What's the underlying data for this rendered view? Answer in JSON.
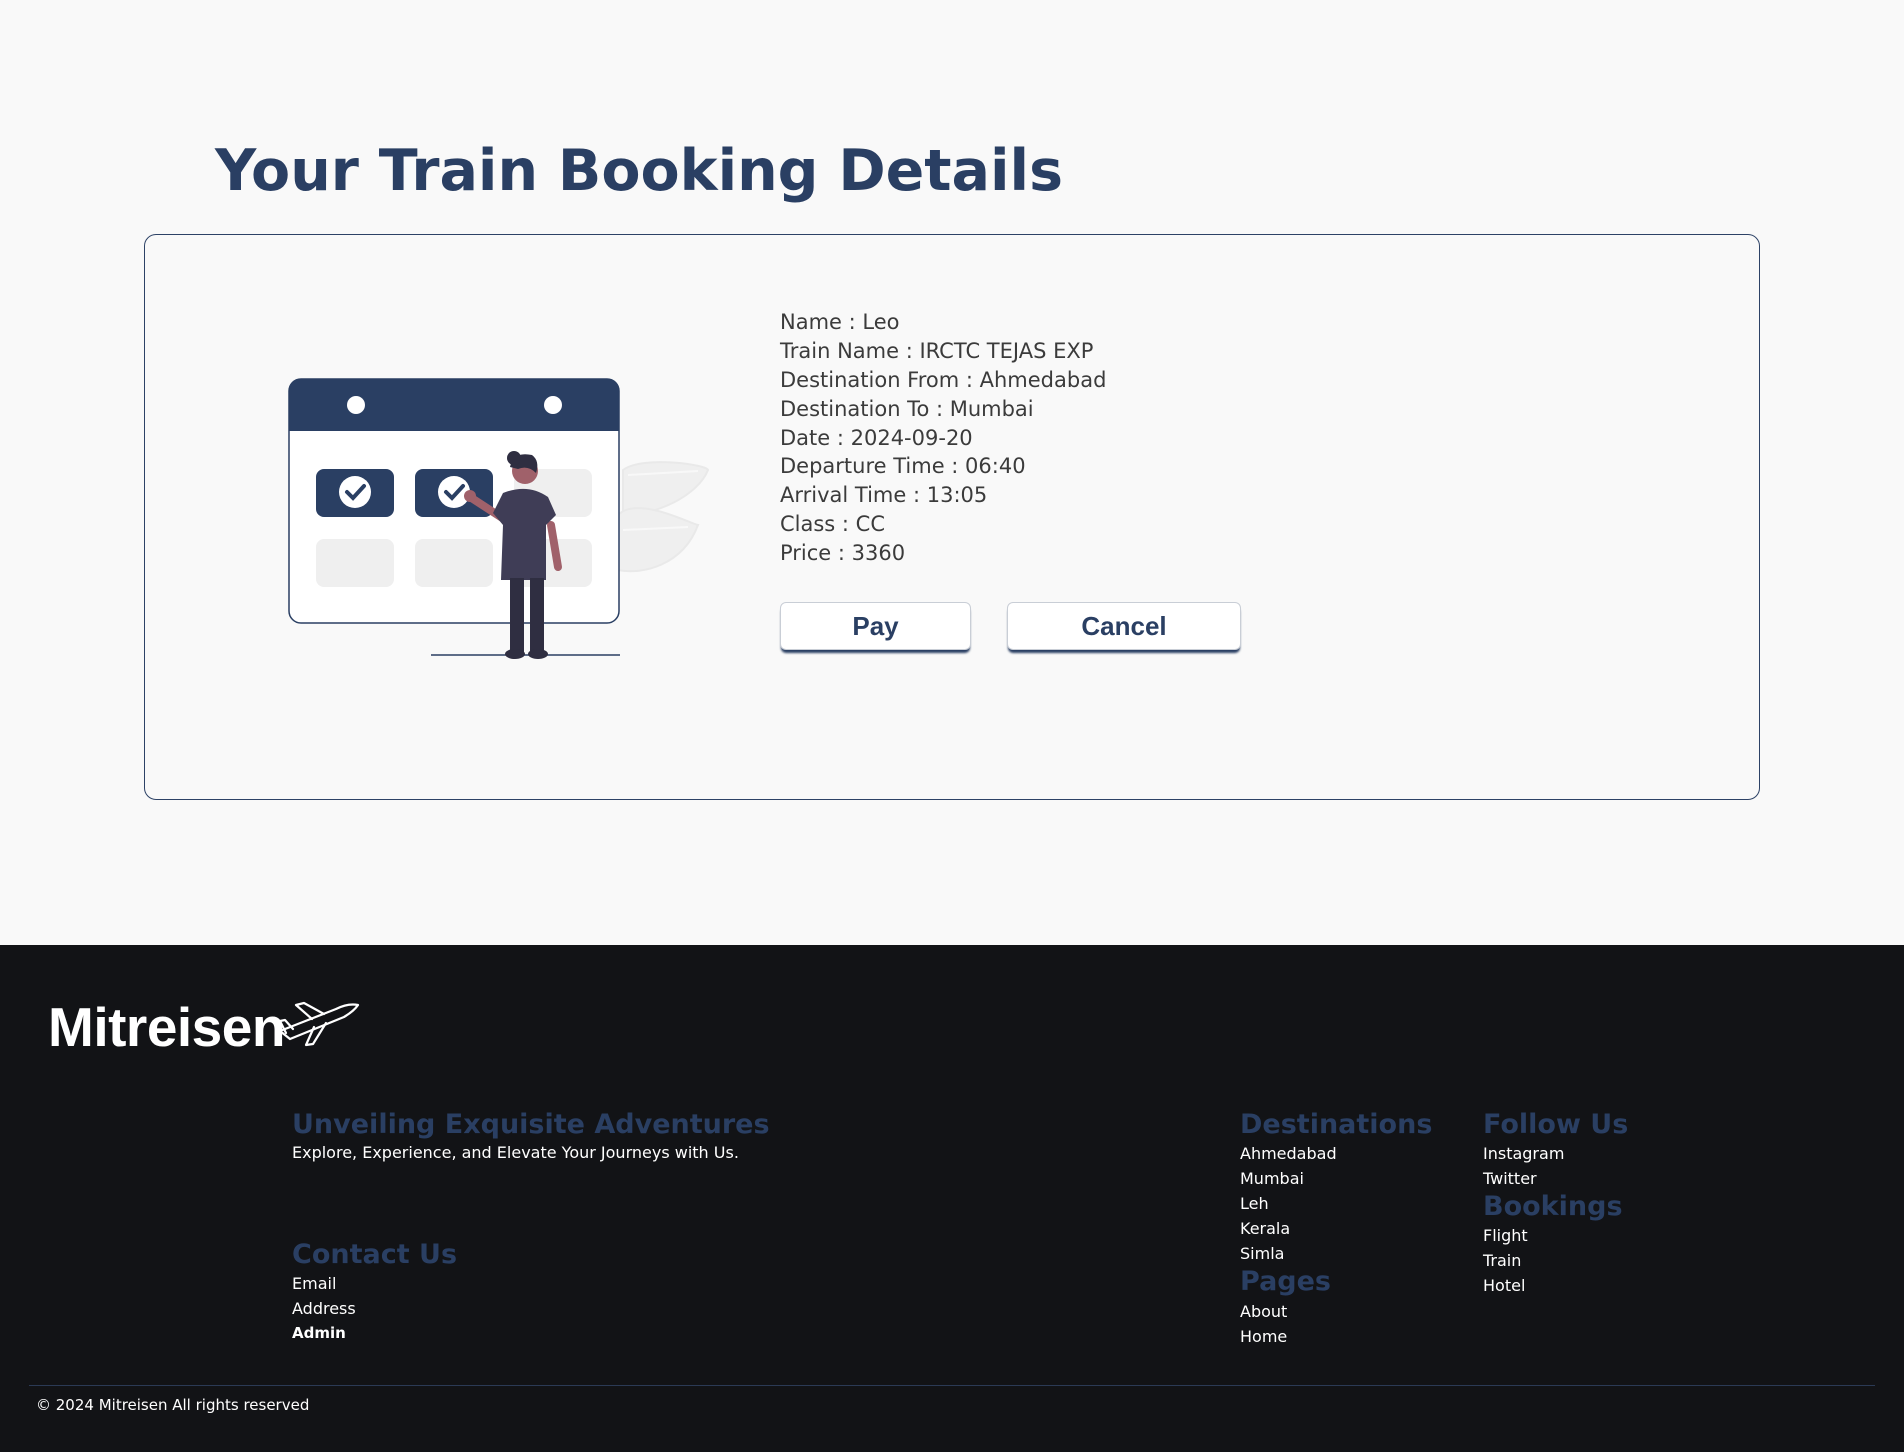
{
  "page": {
    "title": "Your Train Booking Details"
  },
  "booking": {
    "lines": [
      "Name : Leo",
      "Train Name : IRCTC TEJAS EXP",
      "Destination From : Ahmedabad",
      "Destination To : Mumbai",
      "Date : 2024-09-20",
      "Departure Time : 06:40",
      "Arrival Time : 13:05",
      "Class : CC",
      "Price : 3360"
    ],
    "pay_label": "Pay",
    "cancel_label": "Cancel"
  },
  "footer": {
    "brand": "Mitreisen",
    "tagline_title": "Unveiling Exquisite Adventures",
    "tagline_text": "Explore, Experience, and Elevate Your Journeys with Us.",
    "contact": {
      "title": "Contact Us",
      "items": [
        "Email",
        "Address",
        "Admin"
      ]
    },
    "destinations": {
      "title": "Destinations",
      "items": [
        "Ahmedabad",
        "Mumbai",
        "Leh",
        "Kerala",
        "Simla"
      ]
    },
    "pages": {
      "title": "Pages",
      "items": [
        "About",
        "Home"
      ]
    },
    "follow": {
      "title": "Follow Us",
      "items": [
        "Instagram",
        "Twitter"
      ]
    },
    "bookings": {
      "title": "Bookings",
      "items": [
        "Flight",
        "Train",
        "Hotel"
      ]
    },
    "copyright": "© 2024 Mitreisen All rights reserved"
  },
  "colors": {
    "accent": "#2a3f63",
    "footer_bg": "#121316",
    "page_bg": "#f9f9f9"
  },
  "icons": [
    "calendar-illustration",
    "check-icon",
    "airplane-icon"
  ]
}
